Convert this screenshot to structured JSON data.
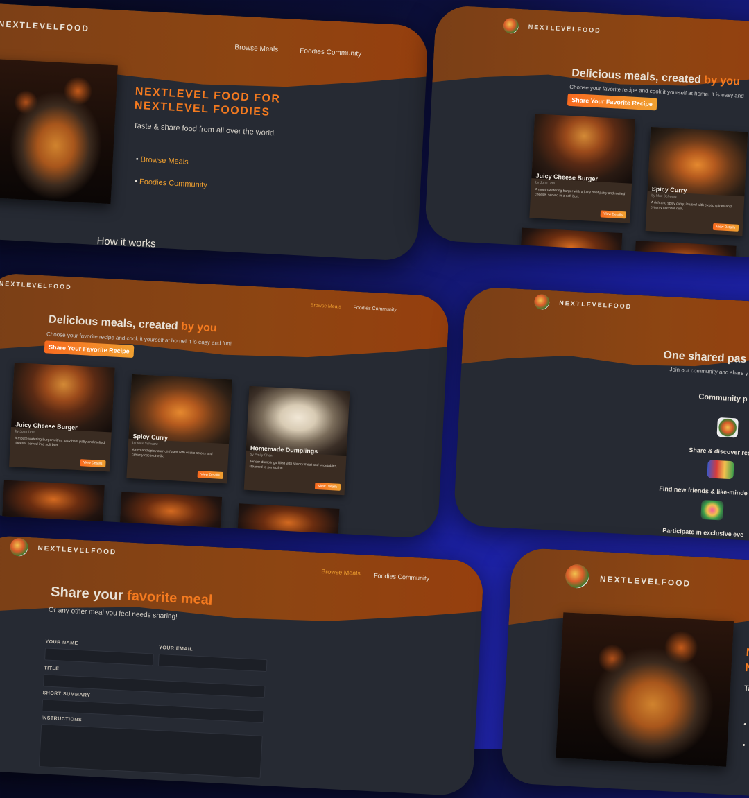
{
  "brand": "NEXTLEVELFOOD",
  "brand_partial": "NEXTLEVELFOOD",
  "nav": {
    "browse": "Browse Meals",
    "community": "Foodies Community"
  },
  "home": {
    "headline_1": "NEXTLEVEL FOOD FOR",
    "headline_2": "NEXTLEVEL FOODIES",
    "tagline": "Taste & share food from all over the world.",
    "links": [
      "Browse Meals",
      "Foodies Community"
    ],
    "how_it_works": "How it works"
  },
  "meals": {
    "title_lead": "Delicious meals, created ",
    "title_accent": "by you",
    "title_accent_partial": "by you",
    "subtitle": "Choose your favorite recipe and cook it yourself at home! It is easy and fun!",
    "subtitle_partial": "Choose your favorite recipe and cook it yourself at home! It is easy and",
    "cta": "Share Your Favorite Recipe",
    "view_details": "View Details",
    "cards": [
      {
        "title": "Juicy Cheese Burger",
        "by": "by John Doe",
        "desc": "A mouth-watering burger with a juicy beef patty and melted cheese, served in a soft bun."
      },
      {
        "title": "Spicy Curry",
        "by": "by Max Schwarz",
        "desc": "A rich and spicy curry, infused with exotic spices and creamy coconut milk."
      },
      {
        "title": "Homemade Dumplings",
        "by": "by Emily Chen",
        "desc": "Tender dumplings filled with savory meat and vegetables, steamed to perfection."
      }
    ]
  },
  "community": {
    "title": "One shared pas",
    "subtitle": "Join our community and share y",
    "perks_title": "Community p",
    "perks": [
      "Share & discover reci",
      "Find new friends & like-minde",
      "Participate in exclusive eve"
    ]
  },
  "share": {
    "title_lead": "Share your ",
    "title_accent": "favorite meal",
    "subtitle": "Or any other meal you feel needs sharing!",
    "labels": {
      "name": "YOUR NAME",
      "email": "YOUR EMAIL",
      "title": "TITLE",
      "summary": "SHORT SUMMARY",
      "instructions": "INSTRUCTIONS"
    }
  },
  "home2": {
    "headline_1": "N",
    "headline_2": "N",
    "tagline": "Ta"
  }
}
